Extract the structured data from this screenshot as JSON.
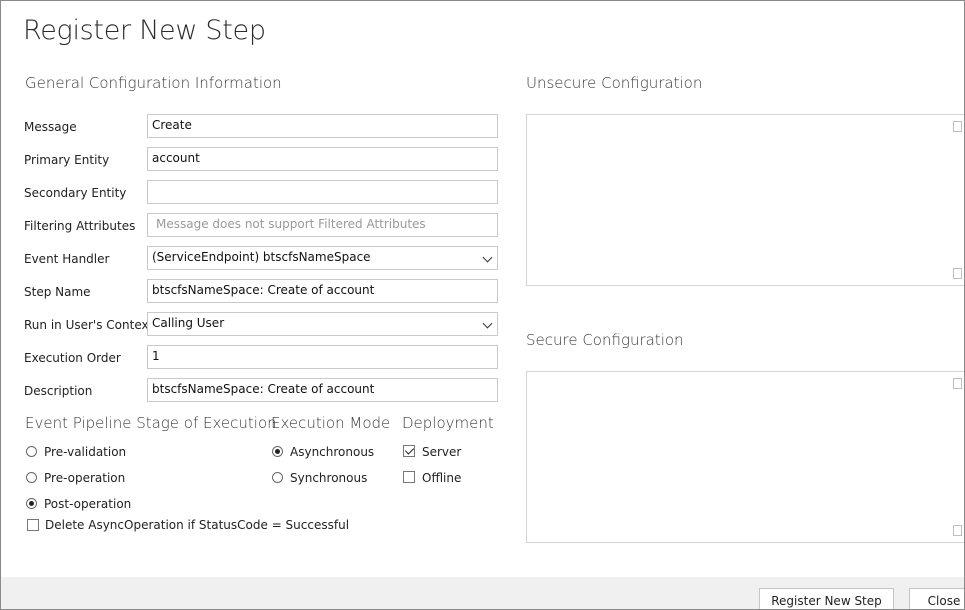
{
  "dialog": {
    "title": "Register New Step"
  },
  "general": {
    "heading": "General Configuration Information",
    "fields": [
      {
        "label": "Message",
        "value": "Create"
      },
      {
        "label": "Primary Entity",
        "value": "account"
      },
      {
        "label": "Secondary Entity",
        "value": ""
      },
      {
        "label": "Filtering Attributes",
        "placeholder": "Message does not support Filtered Attributes"
      },
      {
        "label": "Event Handler",
        "value": "(ServiceEndpoint) btscfsNameSpace"
      },
      {
        "label": "Step Name",
        "value": "btscfsNameSpace: Create of account"
      },
      {
        "label": "Run in User's Context",
        "value": "Calling User"
      },
      {
        "label": "Execution Order",
        "value": "1"
      },
      {
        "label": "Description",
        "value": "btscfsNameSpace: Create of account"
      }
    ]
  },
  "pipeline": {
    "heading": "Event Pipeline Stage of Execution",
    "options": [
      {
        "label": "Pre-validation",
        "selected": false
      },
      {
        "label": "Pre-operation",
        "selected": false
      },
      {
        "label": "Post-operation",
        "selected": true
      }
    ],
    "delete_async": {
      "label": "Delete AsyncOperation if StatusCode = Successful",
      "checked": false
    }
  },
  "execution_mode": {
    "heading": "Execution Mode",
    "options": [
      {
        "label": "Asynchronous",
        "selected": true
      },
      {
        "label": "Synchronous",
        "selected": false
      }
    ]
  },
  "deployment": {
    "heading": "Deployment",
    "options": [
      {
        "label": "Server",
        "checked": true
      },
      {
        "label": "Offline",
        "checked": false
      }
    ]
  },
  "unsecure": {
    "heading": "Unsecure  Configuration"
  },
  "secure": {
    "heading": "Secure  Configuration"
  },
  "buttons": {
    "register": "Register New Step",
    "close": "Close"
  },
  "icons": {
    "dropdown": "chevron-down-icon",
    "checkmark": "check-icon"
  }
}
